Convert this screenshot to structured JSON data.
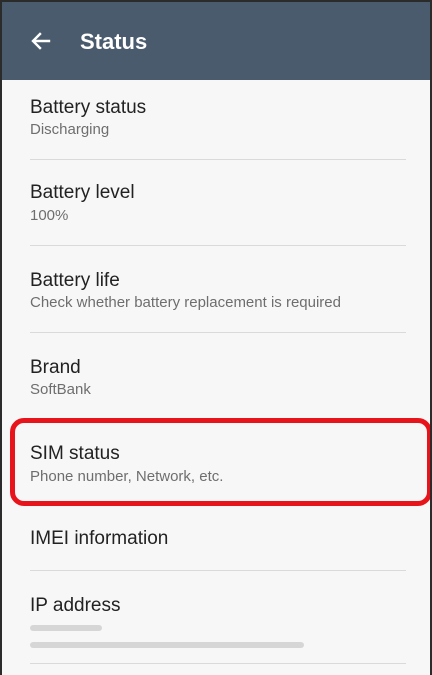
{
  "header": {
    "title": "Status",
    "back_icon": "arrow-back-icon"
  },
  "items": [
    {
      "title": "Battery status",
      "subtitle": "Discharging"
    },
    {
      "title": "Battery level",
      "subtitle": "100%"
    },
    {
      "title": "Battery life",
      "subtitle": "Check whether battery replacement is required"
    },
    {
      "title": "Brand",
      "subtitle": "SoftBank"
    },
    {
      "title": "SIM status",
      "subtitle": "Phone number, Network, etc."
    },
    {
      "title": "IMEI information"
    },
    {
      "title": "IP address"
    }
  ],
  "colors": {
    "appbar": "#4a5b6e",
    "highlight": "#e8141c"
  }
}
